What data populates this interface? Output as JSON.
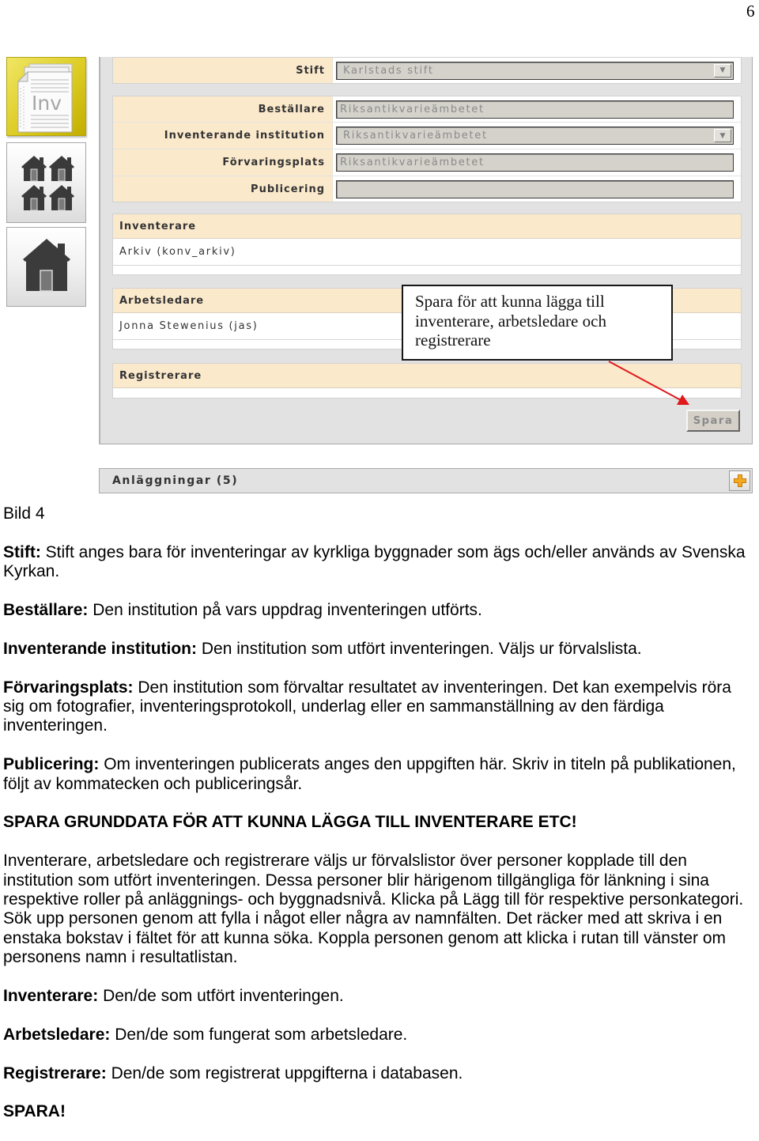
{
  "page": {
    "number": "6"
  },
  "colors": {
    "beige": "#fbe9cc",
    "panel": "#e2e2e2",
    "arrow": "#e0191c",
    "tile": "#d9c928",
    "input": "#d5d2cb"
  },
  "nav": {
    "tiles": [
      {
        "icon": "inventory-document-icon",
        "badge_text": "Inv",
        "active": true
      },
      {
        "icon": "building-group-icon",
        "active": false
      },
      {
        "icon": "single-building-icon",
        "active": false
      }
    ]
  },
  "form": {
    "stift": {
      "label": "Stift",
      "value": "Karlstads stift",
      "type": "select"
    },
    "fields": [
      {
        "label": "Beställare",
        "value": "Riksantikvarieämbetet",
        "type": "text"
      },
      {
        "label": "Inventerande institution",
        "value": "Riksantikvarieämbetet",
        "type": "select"
      },
      {
        "label": "Förvaringsplats",
        "value": "Riksantikvarieämbetet",
        "type": "text"
      },
      {
        "label": "Publicering",
        "value": "",
        "type": "text"
      }
    ],
    "people": [
      {
        "title": "Inventerare",
        "entries": [
          "Arkiv (konv_arkiv)"
        ]
      },
      {
        "title": "Arbetsledare",
        "entries": [
          "Jonna Stewenius (jas)"
        ]
      },
      {
        "title": "Registrerare",
        "entries": []
      }
    ],
    "save_label": "Spara"
  },
  "callout": {
    "text": "Spara för att kunna lägga till inventerare, arbetsledare och registrerare"
  },
  "section": {
    "title": "Anläggningar (5)",
    "add_icon": "plus-icon"
  },
  "doc": {
    "caption": "Bild 4",
    "paragraphs": [
      {
        "label": "Stift:",
        "lines": [
          "Stift anges bara för inventeringar av kyrkliga byggnader som ägs och/eller används av Svenska",
          "Kyrkan."
        ]
      },
      {
        "label": "Beställare:",
        "lines": [
          "Den institution på vars uppdrag inventeringen utförts."
        ]
      },
      {
        "label": "Inventerande institution:",
        "lines": [
          "Den institution som utfört inventeringen. Väljs ur förvalslista."
        ]
      },
      {
        "label": "Förvaringsplats:",
        "lines": [
          "Den institution som förvaltar resultatet av inventeringen. Det kan exempelvis röra",
          "sig om fotografier, inventeringsprotokoll, underlag eller en sammanställning av den färdiga",
          "inventeringen."
        ]
      },
      {
        "label": "Publicering:",
        "lines": [
          "Om inventeringen publicerats anges den uppgiften här. Skriv in titeln på publikationen,",
          "följt av kommatecken och publiceringsår."
        ]
      }
    ],
    "save_heading": "SPARA GRUNDDATA FÖR ATT KUNNA LÄGGA TILL INVENTERARE ETC!",
    "people_intro": [
      "Inventerare, arbetsledare och registrerare väljs ur förvalslistor över personer kopplade till den",
      "institution som utfört inventeringen. Dessa personer blir härigenom tillgängliga för länkning i sina",
      "respektive roller på anläggnings- och byggnadsnivå. Klicka på Lägg till för respektive personkategori.",
      "Sök upp personen genom att fylla i något eller några av namnfälten. Det räcker med att skriva i en",
      "enstaka bokstav i fältet för att kunna söka. Koppla personen genom att klicka i rutan till vänster om",
      "personens namn i resultatlistan."
    ],
    "roles": [
      {
        "label": "Inventerare:",
        "text": "Den/de som utfört inventeringen."
      },
      {
        "label": "Arbetsledare:",
        "text": "Den/de som fungerat som arbetsledare."
      },
      {
        "label": "Registrerare:",
        "text": "Den/de som registrerat uppgifterna i databasen."
      }
    ],
    "final": "SPARA!"
  }
}
